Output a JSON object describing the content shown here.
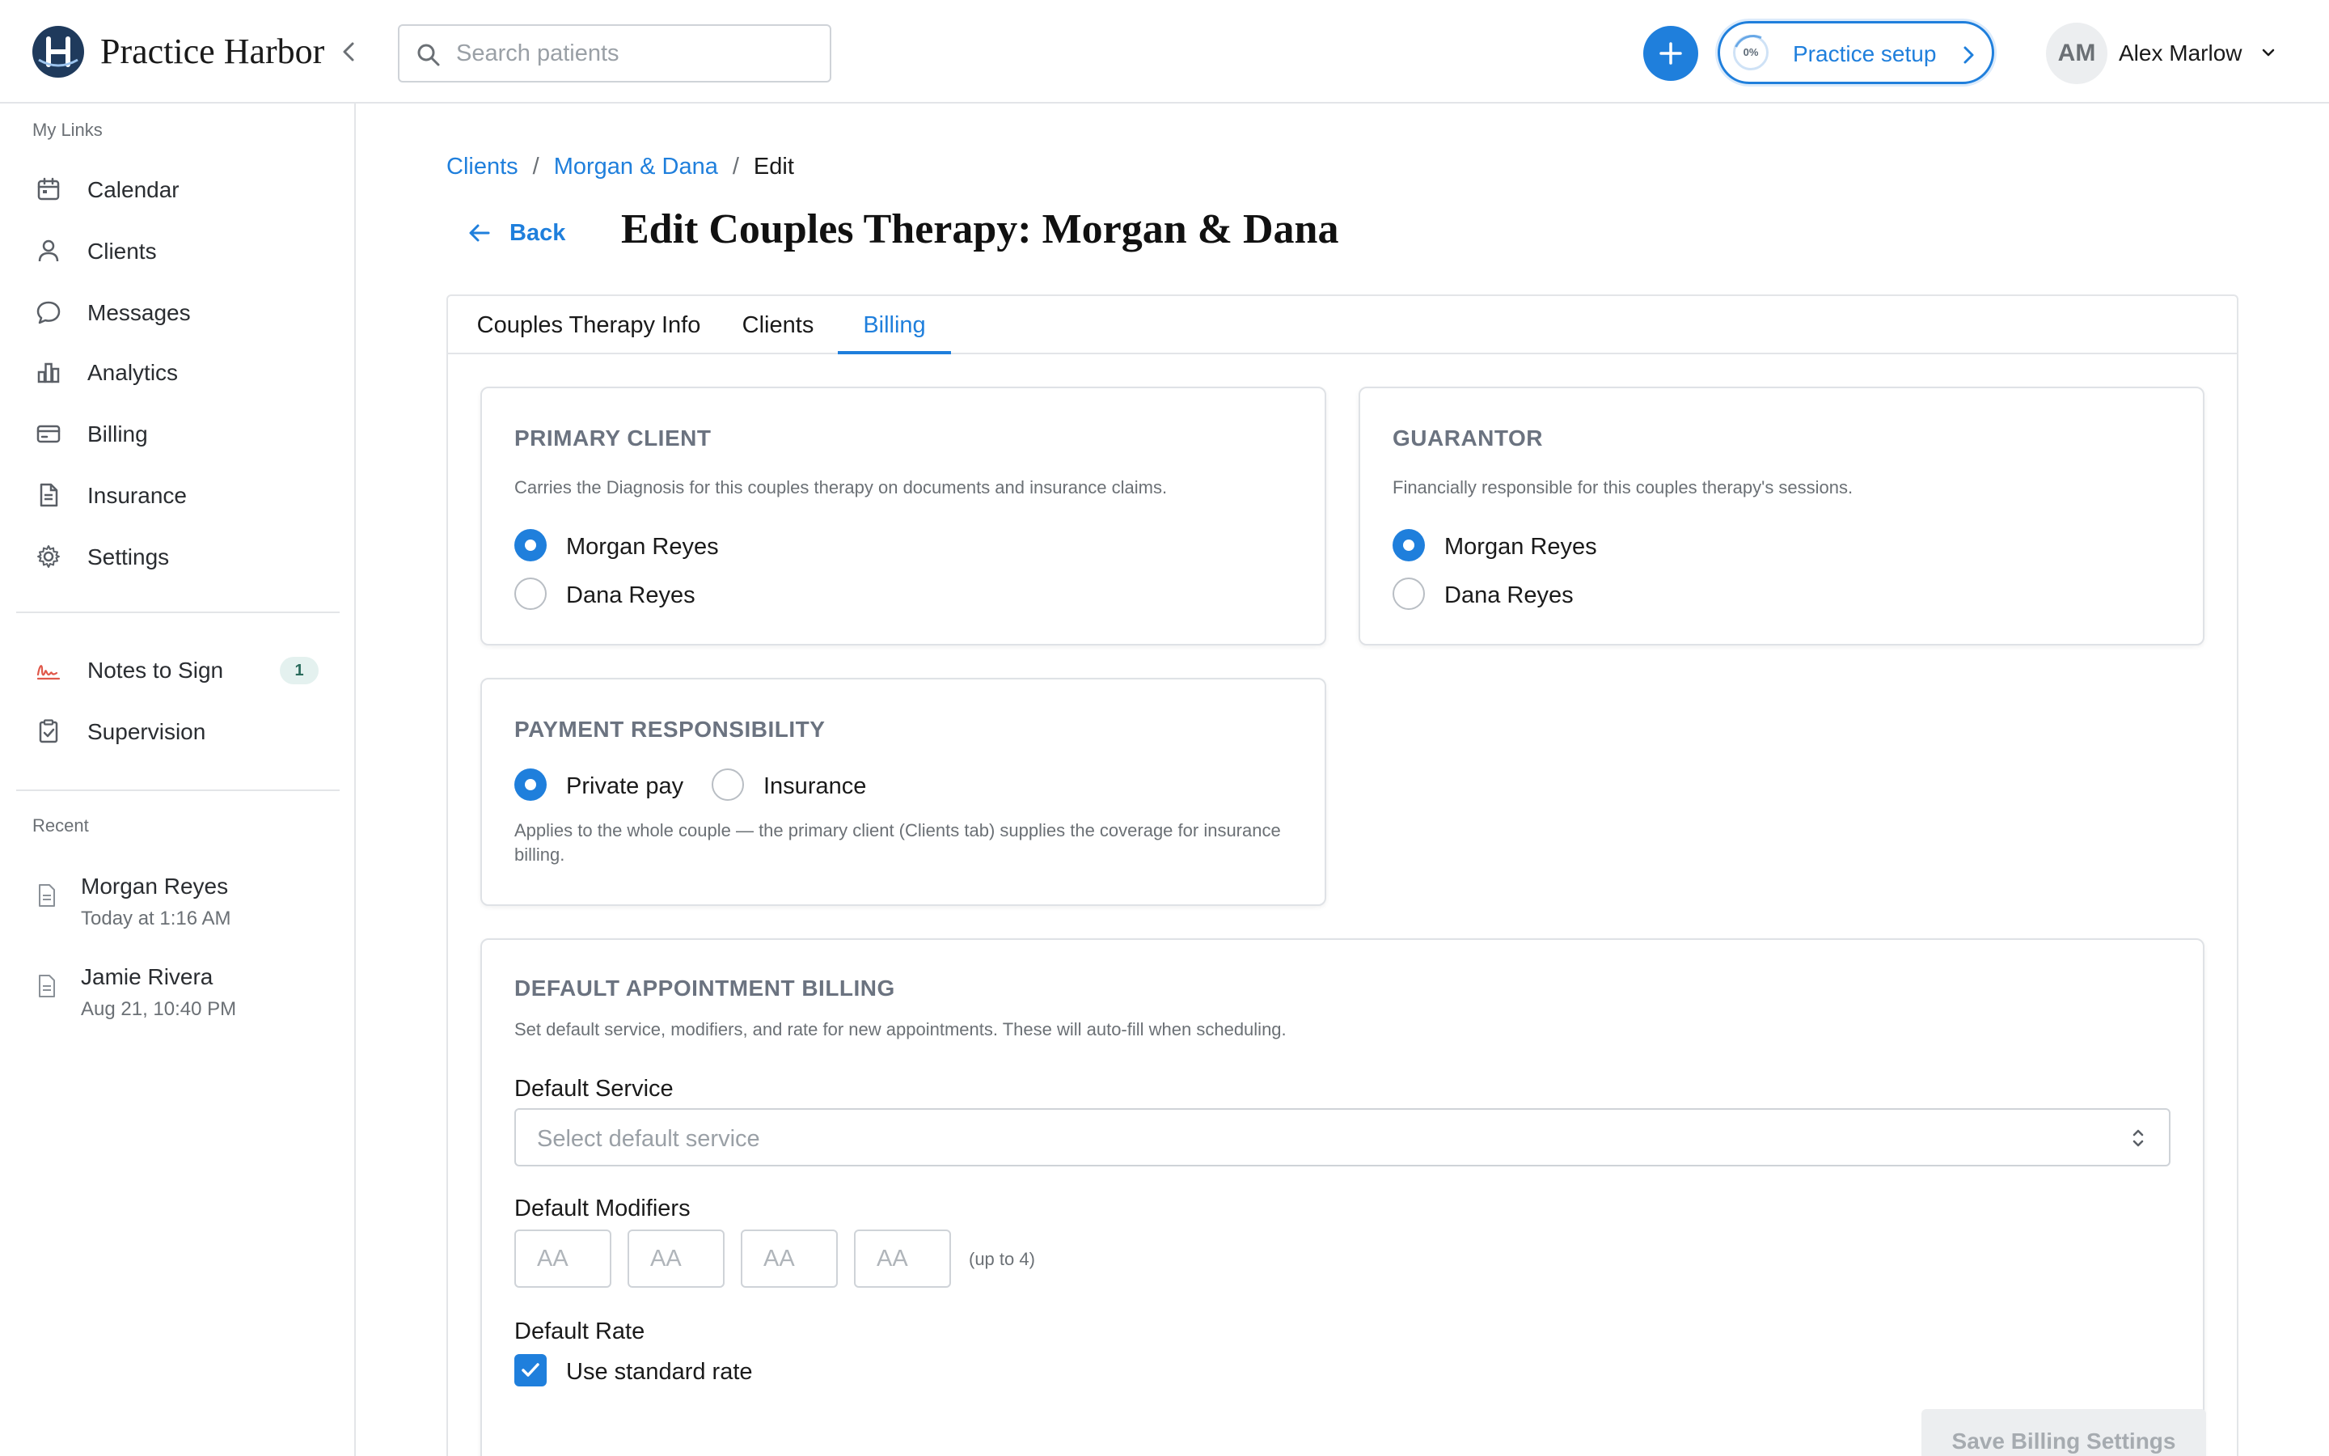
{
  "header": {
    "brand": "Practice Harbor",
    "search_placeholder": "Search patients",
    "setup_progress": "0%",
    "setup_label": "Practice setup",
    "user_initials": "AM",
    "user_name": "Alex Marlow",
    "accent_color": "#1f7fdc"
  },
  "sidebar": {
    "my_links_title": "My Links",
    "items": [
      {
        "label": "Calendar",
        "icon": "calendar-icon"
      },
      {
        "label": "Clients",
        "icon": "person-icon"
      },
      {
        "label": "Messages",
        "icon": "chat-icon"
      },
      {
        "label": "Analytics",
        "icon": "bar-chart-icon"
      },
      {
        "label": "Billing",
        "icon": "card-icon"
      },
      {
        "label": "Insurance",
        "icon": "document-icon"
      },
      {
        "label": "Settings",
        "icon": "gear-icon"
      }
    ],
    "notes_to_sign": {
      "label": "Notes to Sign",
      "count": "1"
    },
    "supervision": {
      "label": "Supervision"
    },
    "recent_title": "Recent",
    "recent": [
      {
        "name": "Morgan Reyes",
        "time": "Today at 1:16 AM"
      },
      {
        "name": "Jamie Rivera",
        "time": "Aug 21, 10:40 PM"
      }
    ]
  },
  "main": {
    "breadcrumb": {
      "root": "Clients",
      "parent": "Morgan & Dana",
      "current": "Edit",
      "separator": "/"
    },
    "back_label": "Back",
    "title": "Edit Couples Therapy: Morgan & Dana",
    "tabs": [
      {
        "label": "Couples Therapy Info"
      },
      {
        "label": "Clients"
      },
      {
        "label": "Billing"
      }
    ],
    "primary_client": {
      "title": "PRIMARY CLIENT",
      "description": "Carries the Diagnosis for this couples therapy on documents and insurance claims.",
      "options": [
        "Morgan Reyes",
        "Dana Reyes"
      ],
      "selected": "Morgan Reyes"
    },
    "guarantor": {
      "title": "GUARANTOR",
      "description": "Financially responsible for this couples therapy's sessions.",
      "options": [
        "Morgan Reyes",
        "Dana Reyes"
      ],
      "selected": "Morgan Reyes"
    },
    "payment": {
      "title": "PAYMENT RESPONSIBILITY",
      "options": [
        "Private pay",
        "Insurance"
      ],
      "selected": "Private pay",
      "note": "Applies to the whole couple — the primary client (Clients tab) supplies the coverage for insurance billing."
    },
    "default_billing": {
      "title": "DEFAULT APPOINTMENT BILLING",
      "description": "Set default service, modifiers, and rate for new appointments. These will auto-fill when scheduling.",
      "service_label": "Default Service",
      "service_placeholder": "Select default service",
      "modifiers_label": "Default Modifiers",
      "modifier_placeholder": "AA",
      "modifiers_hint": "(up to 4)",
      "rate_label": "Default Rate",
      "standard_rate_label": "Use standard rate",
      "save_label": "Save Billing Settings"
    }
  }
}
